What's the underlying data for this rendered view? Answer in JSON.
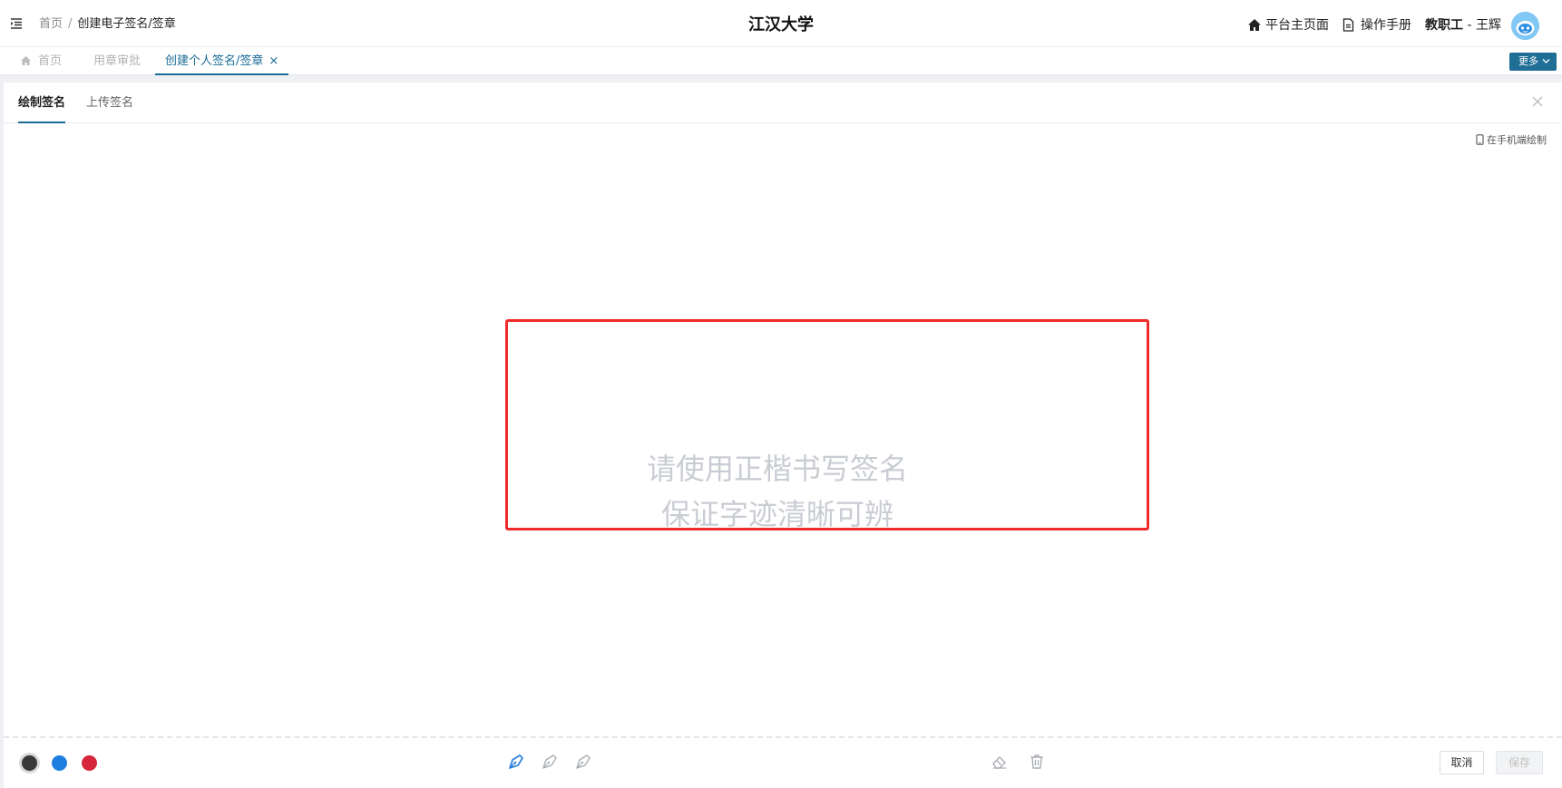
{
  "header": {
    "breadcrumb": {
      "home": "首页",
      "separator": "/",
      "current": "创建电子签名/签章"
    },
    "title": "江汉大学",
    "links": {
      "platform_home": "平台主页面",
      "manual": "操作手册"
    },
    "user": {
      "role": "教职工",
      "separator": " - ",
      "name": "王辉"
    }
  },
  "tabs": {
    "items": [
      {
        "label": "首页"
      },
      {
        "label": "用章审批"
      },
      {
        "label": "创建个人签名/签章",
        "close": "×"
      }
    ],
    "more_label": "更多"
  },
  "signature": {
    "tabs": {
      "draw": "绘制签名",
      "upload": "上传签名"
    },
    "mobile_draw": "在手机端绘制",
    "placeholder": {
      "line1": "请使用正楷书写签名",
      "line2": "保证字迹清晰可辨"
    },
    "pen_colors": [
      "#383838",
      "#1f7fe0",
      "#d6263a"
    ],
    "selected_color": "#383838",
    "tools": [
      "pen-thin-icon",
      "pen-medium-icon",
      "pen-thick-icon",
      "eraser-icon",
      "trash-icon"
    ],
    "cancel_label": "取消",
    "save_label": "保存"
  },
  "colors": {
    "accent": "#1a6c97",
    "highlight": "#ef2b2b",
    "more_button": "#1e6e96"
  }
}
